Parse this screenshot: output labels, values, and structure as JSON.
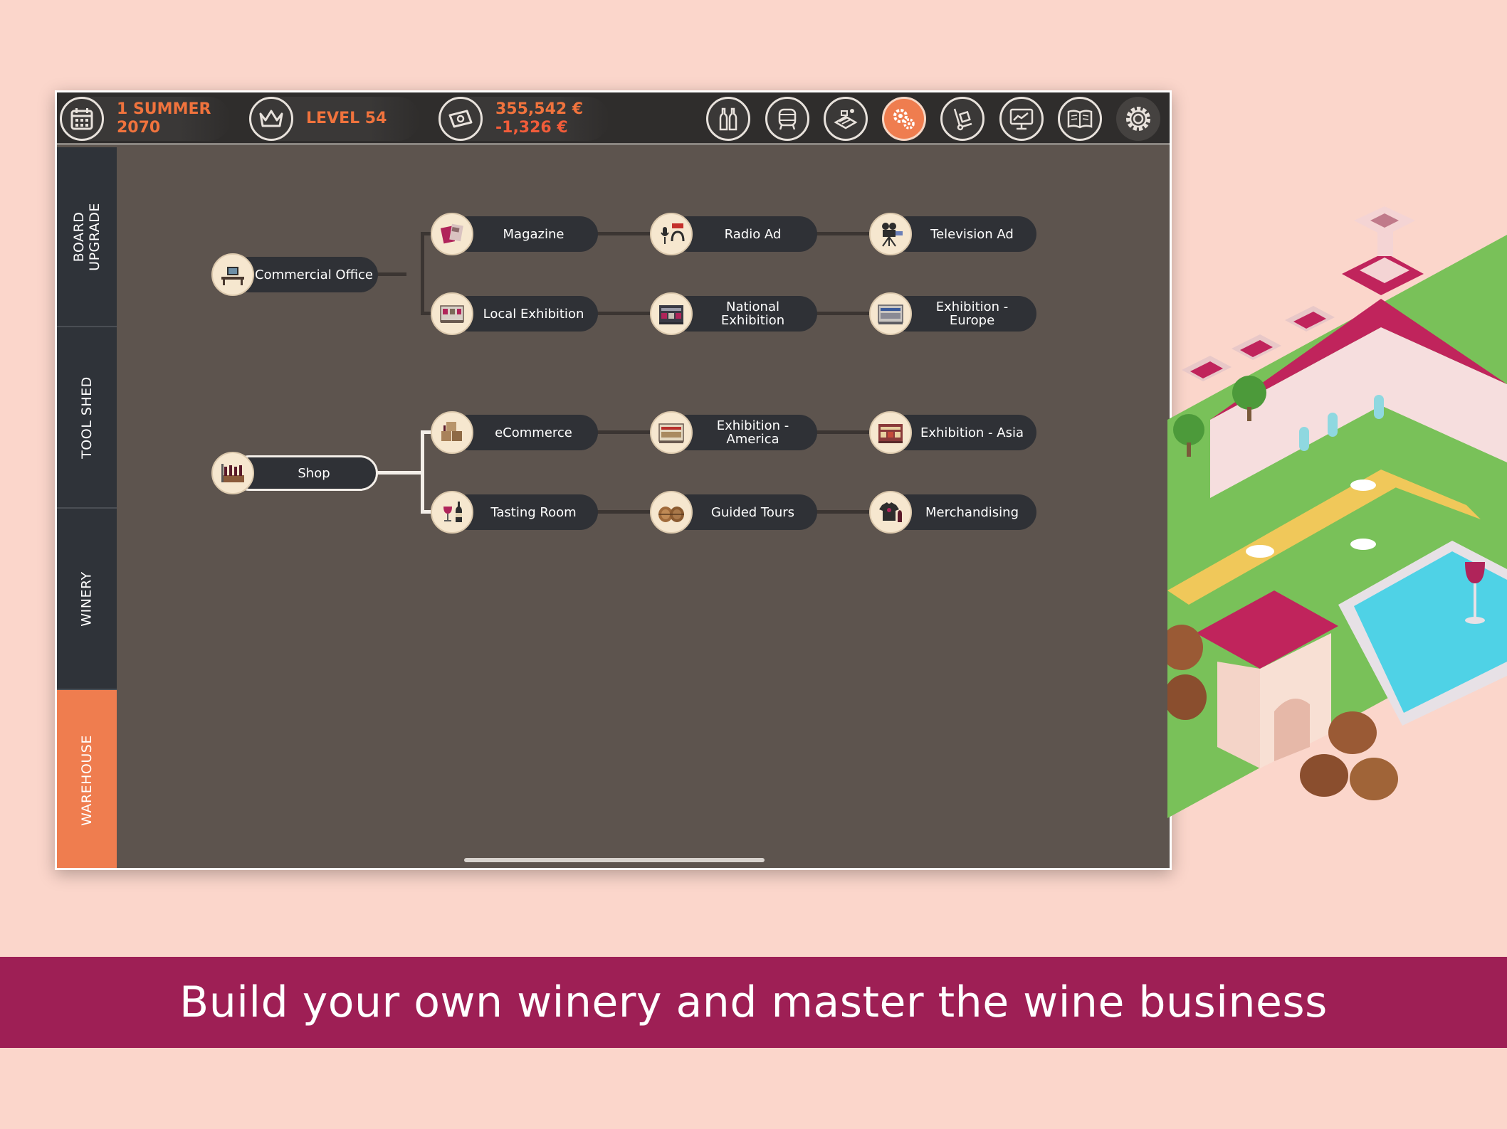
{
  "topbar": {
    "season": "1 SUMMER",
    "year": "2070",
    "level": "LEVEL 54",
    "money": "355,542 €",
    "money_change": "-1,326 €",
    "tools": [
      {
        "icon": "wine-bottles-icon"
      },
      {
        "icon": "wine-barrel-icon"
      },
      {
        "icon": "vineyard-icon"
      },
      {
        "icon": "gears-icon",
        "active": true
      },
      {
        "icon": "hand-truck-icon"
      },
      {
        "icon": "monitor-chart-icon"
      },
      {
        "icon": "book-icon"
      },
      {
        "icon": "settings-gear-icon"
      }
    ]
  },
  "side_tabs": [
    {
      "label_1": "BOARD",
      "label_2": "UPGRADE"
    },
    {
      "label_1": "TOOL SHED"
    },
    {
      "label_1": "WINERY"
    },
    {
      "label_1": "WAREHOUSE",
      "active": true
    }
  ],
  "tree": {
    "commercial_office": "Commercial Office",
    "magazine": "Magazine",
    "radio_ad": "Radio Ad",
    "television_ad": "Television Ad",
    "local_exhibition": "Local Exhibition",
    "national_exhibition": "National Exhibition",
    "exhibition_europe": "Exhibition - Europe",
    "shop": "Shop",
    "ecommerce": "eCommerce",
    "exhibition_america": "Exhibition - America",
    "exhibition_asia": "Exhibition - Asia",
    "tasting_room": "Tasting Room",
    "guided_tours": "Guided Tours",
    "merchandising": "Merchandising"
  },
  "banner": {
    "text": "Build your own winery and master the wine business"
  },
  "colors": {
    "accent_orange": "#ef7d4f",
    "banner_magenta": "#9e1f55",
    "background_pink": "#fbd6cb"
  }
}
